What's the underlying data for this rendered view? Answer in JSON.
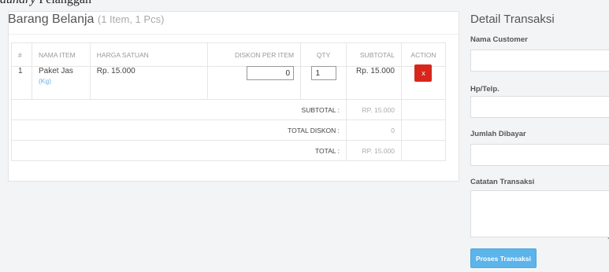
{
  "caption_fragment": {
    "italic": "aundry",
    "plain": " Pelanggan"
  },
  "cart": {
    "title": "Barang Belanja",
    "subtitle": "(1 Item, 1 Pcs)",
    "columns": [
      "#",
      "NAMA ITEM",
      "HARGA SATUAN",
      "DISKON PER ITEM",
      "QTY",
      "SUBTOTAL",
      "ACTION"
    ],
    "items": [
      {
        "no": "1",
        "name": "Paket Jas",
        "unit": "(Kg)",
        "price": "Rp. 15.000",
        "discount": "0",
        "qty": "1",
        "subtotal": "Rp. 15.000",
        "action_label": "x"
      }
    ],
    "summary": {
      "subtotal_label": "SUBTOTAL :",
      "subtotal_value": "RP. 15.000",
      "discount_label": "TOTAL DISKON :",
      "discount_value": "0",
      "total_label": "TOTAL :",
      "total_value": "RP. 15.000"
    }
  },
  "transaction": {
    "title": "Detail Transaksi",
    "customer_label": "Nama Customer",
    "phone_label": "Hp/Telp.",
    "paid_label": "Jumlah Dibayar",
    "notes_label": "Catatan Transaksi",
    "submit_label": "Proses Transaksi"
  },
  "colors": {
    "danger": "#d9261c",
    "primary": "#5bb4ea",
    "link": "#6ab0e3"
  }
}
